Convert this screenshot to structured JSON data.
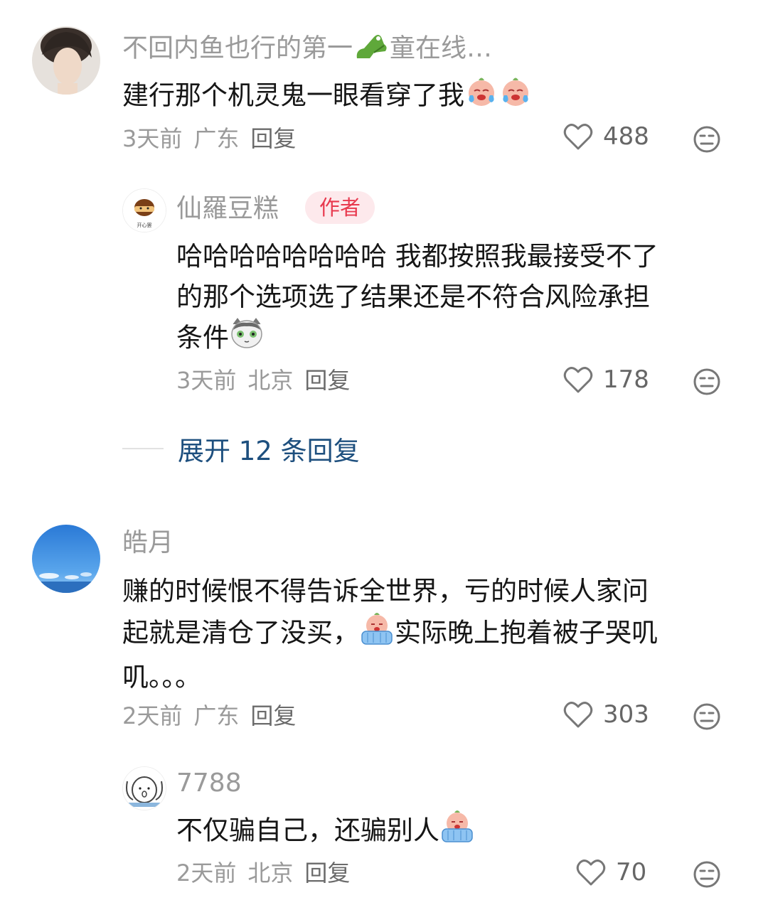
{
  "comments": [
    {
      "username": "不回内鱼也行的第一",
      "username_tail": "童在线…",
      "text": "建行那个机灵鬼一眼看穿了我",
      "time": "3天前",
      "location": "广东",
      "reply_label": "回复",
      "likes": "488",
      "icons": [
        "crocodile-icon",
        "crying-face-icon",
        "heart-icon",
        "meh-face-icon"
      ]
    },
    {
      "username": "仙羅豆糕",
      "author_badge": "作者",
      "avatar_text": "开心罢",
      "text_line1": "哈哈哈哈哈哈哈哈 我都按照我最接受不了",
      "text_line2": "的那个选项选了结果还是不符合风险承担",
      "text_line3": "条件",
      "time": "3天前",
      "location": "北京",
      "reply_label": "回复",
      "likes": "178"
    },
    {
      "expand_label": "展开 12 条回复"
    },
    {
      "username": "皓月",
      "text_line1": "赚的时候恨不得告诉全世界，亏的时候人家问",
      "text_line2a": "起就是清仓了没买，",
      "text_line2b": "实际晚上抱着被子哭叽",
      "text_line3": "叽。。。",
      "time": "2天前",
      "location": "广东",
      "reply_label": "回复",
      "likes": "303"
    },
    {
      "username": "7788",
      "text": "不仅骗自己，还骗别人",
      "time": "2天前",
      "location": "北京",
      "reply_label": "回复",
      "likes": "70"
    }
  ],
  "colors": {
    "link": "#1d4f7e",
    "badge_bg": "#fde9ec",
    "badge_text": "#e8394e",
    "meta": "#9a9a9a"
  }
}
